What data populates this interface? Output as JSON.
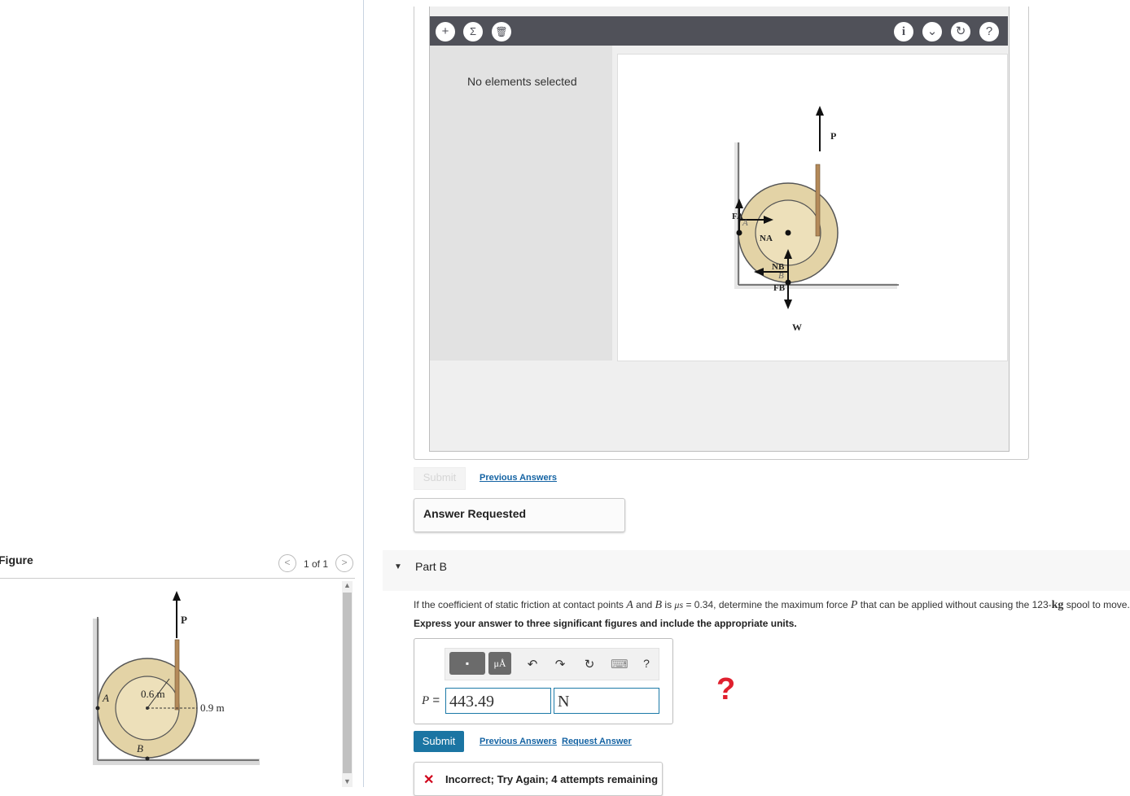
{
  "figure": {
    "title": "Figure",
    "counter": "1 of 1",
    "prev_icon": "chevron-left-icon",
    "next_icon": "chevron-right-icon",
    "labels": {
      "force": "P",
      "point_a": "A",
      "point_b": "B",
      "inner_radius": "0.6 m",
      "outer_radius": "0.9 m"
    }
  },
  "workspace": {
    "empty_text": "No elements selected",
    "toolbar_left": [
      {
        "icon": "plus-icon",
        "glyph": "+"
      },
      {
        "icon": "sigma-icon",
        "glyph": "Σ"
      },
      {
        "icon": "trash-icon",
        "glyph": "🗑"
      }
    ],
    "toolbar_right": [
      {
        "icon": "info-icon",
        "glyph": "i"
      },
      {
        "icon": "chevron-down-icon",
        "glyph": "⌄"
      },
      {
        "icon": "reset-icon",
        "glyph": "↻"
      },
      {
        "icon": "help-icon",
        "glyph": "?"
      }
    ],
    "fbd_labels": {
      "p": "P",
      "na": "NA",
      "fa": "FA",
      "a": "A",
      "nb": "NB",
      "b": "B",
      "fb": "FB",
      "w": "W"
    }
  },
  "part_a": {
    "submit_label": "Submit",
    "previous_answers": "Previous Answers",
    "status": "Answer Requested"
  },
  "part_b": {
    "title": "Part B",
    "question": "If the coefficient of static friction at contact points A and B is μs = 0.34, determine the maximum force P that can be applied without causing the 123-kg spool to move.",
    "question_parts": {
      "pre": "If the coefficient of static friction at contact points ",
      "a": "A",
      "and": " and ",
      "b": "B",
      "is": " is ",
      "mu": "μs",
      "eq": " = 0.34, determine the maximum force ",
      "p": "P",
      "mid": " that can be applied without causing the 123-",
      "kg": "kg",
      "post": " spool to move."
    },
    "instruction": "Express your answer to three significant figures and include the appropriate units.",
    "tools": {
      "templates": "▪",
      "units": "μÅ",
      "undo": "↶",
      "redo": "↷",
      "reset": "↻",
      "keyboard": "⌨",
      "help": "?"
    },
    "variable": "P",
    "equals": "=",
    "value": "443.49",
    "unit": "N",
    "submit_label": "Submit",
    "previous_answers": "Previous Answers",
    "request_answer": "Request Answer",
    "feedback": "Incorrect; Try Again; 4 attempts remaining",
    "feedback_icon": "x-icon",
    "hint_mark": "?"
  }
}
